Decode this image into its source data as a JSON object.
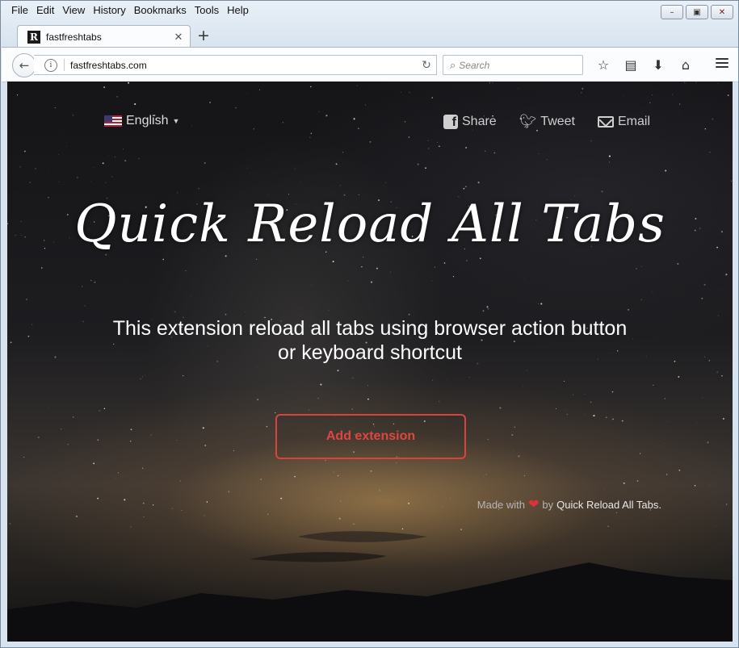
{
  "menu": [
    {
      "label": "File"
    },
    {
      "label": "Edit"
    },
    {
      "label": "View"
    },
    {
      "label": "History"
    },
    {
      "label": "Bookmarks"
    },
    {
      "label": "Tools"
    },
    {
      "label": "Help"
    }
  ],
  "window_controls": {
    "minimize": "minimize-icon",
    "maximize": "maximize-icon",
    "close": "close-icon"
  },
  "tab": {
    "title": "fastfreshtabs",
    "favicon": "R"
  },
  "address": {
    "url": "fastfreshtabs.com"
  },
  "search": {
    "placeholder": "Search"
  },
  "toolbar_icons": [
    "star-icon",
    "reading-list-icon",
    "download-icon",
    "home-icon",
    "menu-icon"
  ],
  "page": {
    "language": "English",
    "social": {
      "share": "Share",
      "tweet": "Tweet",
      "email": "Email"
    },
    "headline": "Quick Reload All Tabs",
    "subtitle_line1": "This extension reload all tabs using browser action button",
    "subtitle_line2": "or keyboard shortcut",
    "cta": "Add extension",
    "credit": {
      "made_with": "Made with",
      "by": "by",
      "app_name": "Quick Reload All Tabs",
      "suffix": "."
    }
  },
  "colors": {
    "accent": "#e0463f",
    "heart": "#e0303a"
  }
}
